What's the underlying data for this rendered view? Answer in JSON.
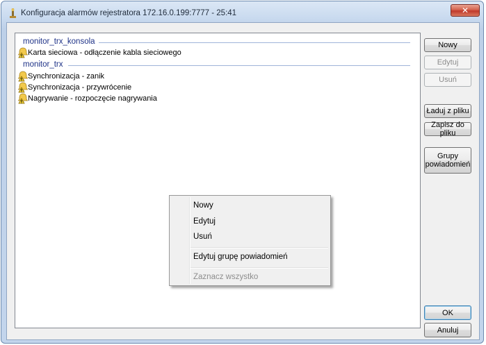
{
  "window": {
    "title": "Konfiguracja alarmów rejestratora 172.16.0.199:7777 - 25:41",
    "close_label": "✕"
  },
  "alarm_groups": [
    {
      "name": "monitor_trx_konsola",
      "items": [
        {
          "label": "Karta sieciowa - odłączenie kabla sieciowego",
          "icon": "warning-bell-icon"
        }
      ]
    },
    {
      "name": "monitor_trx",
      "items": [
        {
          "label": "Synchronizacja - zanik",
          "icon": "warning-bell-icon"
        },
        {
          "label": "Synchronizacja - przywrócenie",
          "icon": "warning-bell-icon"
        },
        {
          "label": "Nagrywanie - rozpoczęcie nagrywania",
          "icon": "warning-bell-icon"
        }
      ]
    }
  ],
  "buttons": {
    "new": "Nowy",
    "edit": "Edytuj",
    "delete": "Usuń",
    "load": "Ładuj z pliku",
    "save": "Zapisz do pliku",
    "groups_line1": "Grupy",
    "groups_line2": "powiadomień",
    "ok": "OK",
    "cancel": "Anuluj"
  },
  "context_menu": {
    "new": "Nowy",
    "edit": "Edytuj",
    "delete": "Usuń",
    "edit_group": "Edytuj grupę powiadomień",
    "select_all": "Zaznacz wszystko"
  },
  "colors": {
    "group_header": "#1e3287",
    "close_button": "#c0392b",
    "title_bar": "#c9daef"
  }
}
